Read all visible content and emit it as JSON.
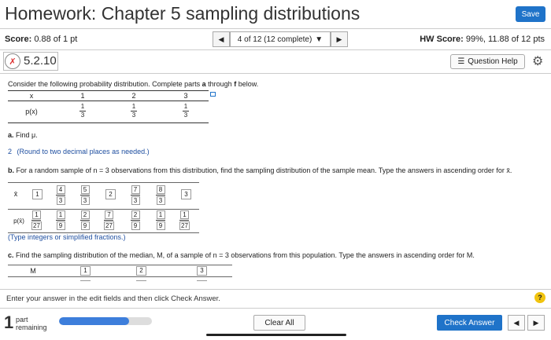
{
  "header": {
    "title": "Homework: Chapter 5 sampling distributions",
    "save_label": "Save"
  },
  "score": {
    "label": "Score:",
    "value": "0.88 of 1 pt",
    "hw_label": "HW Score:",
    "hw_value": "99%, 11.88 of 12 pts"
  },
  "nav": {
    "position": "4 of 12 (12 complete)",
    "prev_icon": "triangle-left-icon",
    "next_icon": "triangle-right-icon"
  },
  "problem": {
    "number": "5.2.10",
    "help_label": "Question Help"
  },
  "question": {
    "intro_pre": "Consider the following probability distribution. Complete parts ",
    "intro_a": "a",
    "intro_mid": " through ",
    "intro_f": "f",
    "intro_post": " below.",
    "dist_x_label": "x",
    "dist_p_label": "p(x)",
    "dist_x": [
      "1",
      "2",
      "3"
    ],
    "dist_p": [
      [
        "1",
        "3"
      ],
      [
        "1",
        "3"
      ],
      [
        "1",
        "3"
      ]
    ],
    "part_a_label": "a.",
    "part_a_text": " Find μ.",
    "part_a_answer": "2",
    "part_a_hint": "(Round to two decimal places as needed.)",
    "part_b_label": "b.",
    "part_b_text": " For a random sample of n = 3 observations from this distribution, find the sampling distribution of the sample mean. Type the answers in ascending order for x̄.",
    "xbar_label": "x̄",
    "pxbar_label": "p(x̄)",
    "xbar_values": [
      [
        "1"
      ],
      [
        "4",
        "3"
      ],
      [
        "5",
        "3"
      ],
      [
        "2"
      ],
      [
        "7",
        "3"
      ],
      [
        "8",
        "3"
      ],
      [
        "3"
      ]
    ],
    "pxbar_values": [
      [
        "1",
        "27"
      ],
      [
        "1",
        "9"
      ],
      [
        "2",
        "9"
      ],
      [
        "7",
        "27"
      ],
      [
        "2",
        "9"
      ],
      [
        "1",
        "9"
      ],
      [
        "1",
        "27"
      ]
    ],
    "part_b_hint": "(Type integers or simplified fractions.)",
    "part_c_label": "c.",
    "part_c_text": " Find the sampling distribution of the median, M, of a sample of n = 3 observations from this population. Type the answers in ascending order for M.",
    "m_label": "M",
    "m_values": [
      "1",
      "2",
      "3"
    ]
  },
  "footer": {
    "instruction": "Enter your answer in the edit fields and then click Check Answer.",
    "part_count": "1",
    "part_label_1": "part",
    "part_label_2": "remaining",
    "progress": 0.75,
    "clear_label": "Clear All",
    "check_label": "Check Answer"
  },
  "colors": {
    "accent": "#1f73c9",
    "progress": "#3d7edb"
  }
}
